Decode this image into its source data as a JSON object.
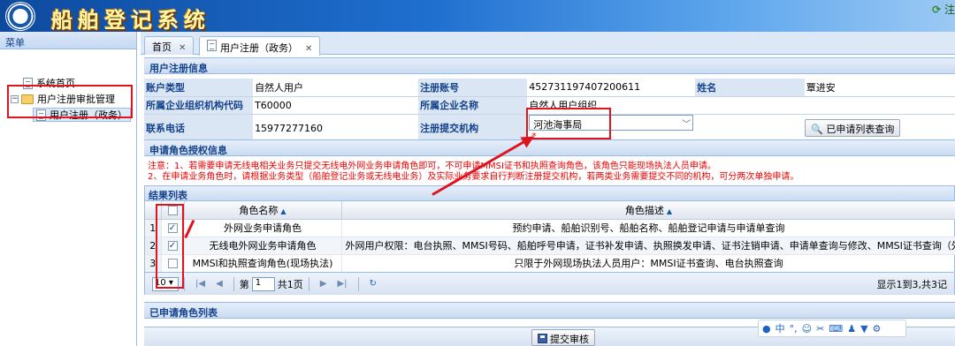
{
  "app": {
    "title": "船舶登记系统",
    "top_right": "注"
  },
  "menu": {
    "header": "菜单",
    "items": [
      {
        "label": "系统首页"
      },
      {
        "label": "用户注册审批管理"
      },
      {
        "label": "用户注册（政务）"
      }
    ]
  },
  "tabs": [
    {
      "label": "首页"
    },
    {
      "label": "用户注册（政务）"
    }
  ],
  "user_info": {
    "section_title": "用户注册信息",
    "account_type_label": "账户类型",
    "account_type_value": "自然人用户",
    "reg_account_label": "注册账号",
    "reg_account_value": "452731197407200611",
    "name_label": "姓名",
    "name_value": "覃进安",
    "org_code_label": "所属企业组织机构代码",
    "org_code_value": "T60000",
    "org_name_label": "所属企业名称",
    "org_name_value": "自然人用户组织",
    "phone_label": "联系电话",
    "phone_value": "15977277160",
    "submit_org_label": "注册提交机构",
    "submit_org_value": "河池海事局",
    "query_button": "已申请列表查询"
  },
  "role_auth": {
    "section_title": "申请角色授权信息",
    "notice_line1": "注意：1、若需要申请无线电相关业务只提交无线电外网业务申请角色即可，不可申请MMSI证书和执照查询角色，该角色只能现场执法人员申请。",
    "notice_line2": "2、在申请业务角色时，请根据业务类型（船舶登记业务或无线电业务）及实际业务要求自行判断注册提交机构，若两类业务需要提交不同的机构，可分两次单独申请。"
  },
  "result_list": {
    "title": "结果列表",
    "col_role": "角色名称",
    "col_desc": "角色描述",
    "rows": [
      {
        "num": "1",
        "checked": "✓",
        "role": "外网业务申请角色",
        "desc": "预约申请、船舶识别号、船舶名称、船舶登记申请与申请单查询"
      },
      {
        "num": "2",
        "checked": "✓",
        "role": "无线电外网业务申请角色",
        "desc": "外网用户权限：电台执照、MMSI号码、船舶呼号申请，证书补发申请、执照换发申请、证书注销申请、申请单查询与修改、MMSI证书查询（外网）、电"
      },
      {
        "num": "3",
        "checked": "",
        "role": "MMSI和执照查询角色(现场执法)",
        "desc": "只限于外网现场执法人员用户：MMSI证书查询、电台执照查询"
      }
    ]
  },
  "pager": {
    "page_size": "10",
    "page_prefix": "第",
    "page_value": "1",
    "page_total": "共1页",
    "info": "显示1到3,共3记"
  },
  "applied": {
    "section_title": "已申请角色列表"
  },
  "submit": {
    "label": "提交审核"
  },
  "ime": {
    "mode": "中"
  },
  "colors": {
    "accent": "#15428b",
    "highlight_red": "#e0141e",
    "banner_blue": "#1f6fcf"
  }
}
